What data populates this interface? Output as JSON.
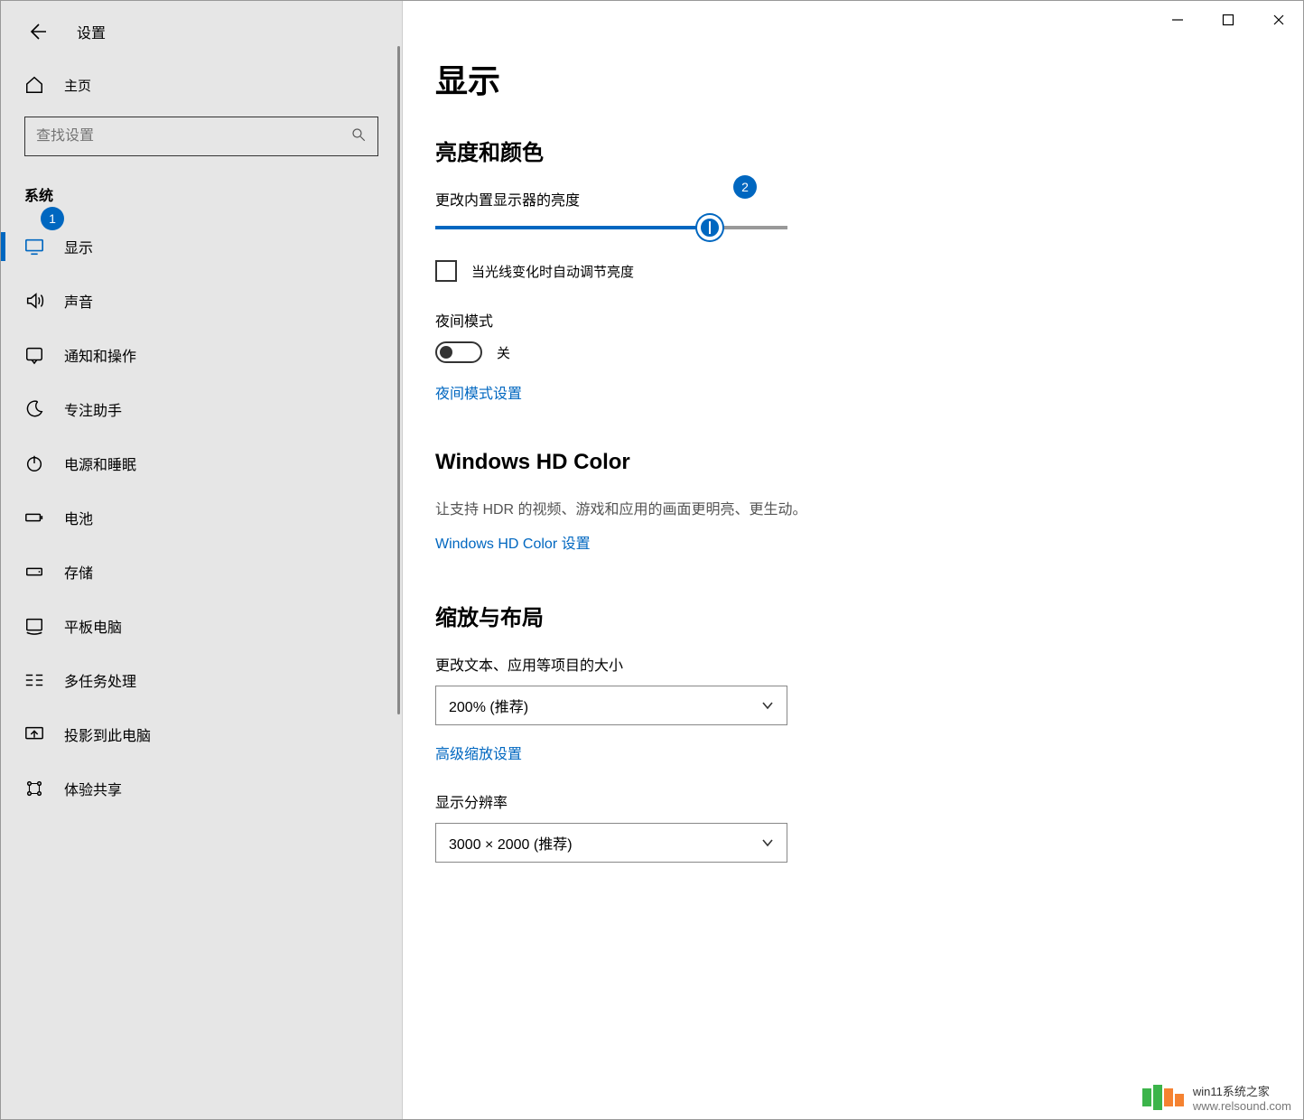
{
  "app_title": "设置",
  "home_label": "主页",
  "search_placeholder": "查找设置",
  "category_label": "系统",
  "sidebar": {
    "items": [
      {
        "label": "显示",
        "icon": "monitor"
      },
      {
        "label": "声音",
        "icon": "sound"
      },
      {
        "label": "通知和操作",
        "icon": "notification"
      },
      {
        "label": "专注助手",
        "icon": "moon"
      },
      {
        "label": "电源和睡眠",
        "icon": "power"
      },
      {
        "label": "电池",
        "icon": "battery"
      },
      {
        "label": "存储",
        "icon": "storage"
      },
      {
        "label": "平板电脑",
        "icon": "tablet"
      },
      {
        "label": "多任务处理",
        "icon": "multitask"
      },
      {
        "label": "投影到此电脑",
        "icon": "project"
      },
      {
        "label": "体验共享",
        "icon": "share"
      }
    ]
  },
  "page": {
    "title": "显示",
    "brightness": {
      "heading": "亮度和颜色",
      "slider_label": "更改内置显示器的亮度",
      "slider_percent": 78,
      "auto_adjust_label": "当光线变化时自动调节亮度"
    },
    "night": {
      "label": "夜间模式",
      "state": "关",
      "settings_link": "夜间模式设置"
    },
    "hdr": {
      "heading": "Windows HD Color",
      "desc": "让支持 HDR 的视频、游戏和应用的画面更明亮、更生动。",
      "link": "Windows HD Color 设置"
    },
    "scale": {
      "heading": "缩放与布局",
      "scale_label": "更改文本、应用等项目的大小",
      "scale_value": "200% (推荐)",
      "advanced_link": "高级缩放设置",
      "resolution_label": "显示分辨率",
      "resolution_value": "3000 × 2000 (推荐)"
    }
  },
  "annotations": {
    "badge1": "1",
    "badge2": "2"
  },
  "watermark": {
    "line1": "win11系统之家",
    "line2": "www.relsound.com"
  }
}
